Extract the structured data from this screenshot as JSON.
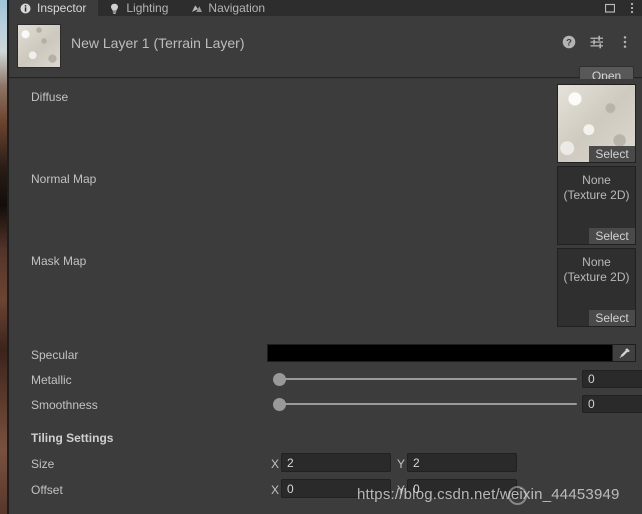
{
  "window": {
    "tabs": [
      {
        "label": "Inspector",
        "icon": "info-icon",
        "active": true
      },
      {
        "label": "Lighting",
        "icon": "lightbulb-icon",
        "active": false
      },
      {
        "label": "Navigation",
        "icon": "navmesh-icon",
        "active": false
      }
    ],
    "controls": [
      {
        "name": "maximize-icon",
        "glyph": "□"
      },
      {
        "name": "kebab-menu-icon",
        "glyph": "⋮"
      }
    ]
  },
  "header": {
    "title": "New Layer 1 (Terrain Layer)",
    "thumbnail_name": "terrain-layer-thumbnail",
    "icons": [
      {
        "name": "help-icon"
      },
      {
        "name": "preset-icon"
      },
      {
        "name": "kebab-menu-icon"
      }
    ],
    "open_label": "Open"
  },
  "texture_slots": [
    {
      "label": "Diffuse",
      "has_preview": true,
      "value": "",
      "value_line2": "",
      "select_label": "Select"
    },
    {
      "label": "Normal Map",
      "has_preview": false,
      "value": "None",
      "value_line2": "(Texture 2D)",
      "select_label": "Select"
    },
    {
      "label": "Mask Map",
      "has_preview": false,
      "value": "None",
      "value_line2": "(Texture 2D)",
      "select_label": "Select"
    }
  ],
  "properties": {
    "specular": {
      "label": "Specular",
      "color": "#000000",
      "eyedropper_name": "eyedropper-icon"
    },
    "metallic": {
      "label": "Metallic",
      "value": "0",
      "slider_fraction": 0
    },
    "smoothness": {
      "label": "Smoothness",
      "value": "0",
      "slider_fraction": 0
    }
  },
  "tiling": {
    "section_label": "Tiling Settings",
    "size": {
      "label": "Size",
      "x_label": "X",
      "x": "2",
      "y_label": "Y",
      "y": "2"
    },
    "offset": {
      "label": "Offset",
      "x_label": "X",
      "x": "0",
      "y_label": "Y",
      "y": "0"
    }
  },
  "watermark": {
    "text": "https://blog.csdn.net/weixin_44453949"
  },
  "colors": {
    "panel_bg": "#3c3c3c",
    "tabbar_bg": "#2d2d2d",
    "field_bg": "#2a2a2a",
    "text": "#c2c2c2",
    "button_bg": "#585858"
  }
}
